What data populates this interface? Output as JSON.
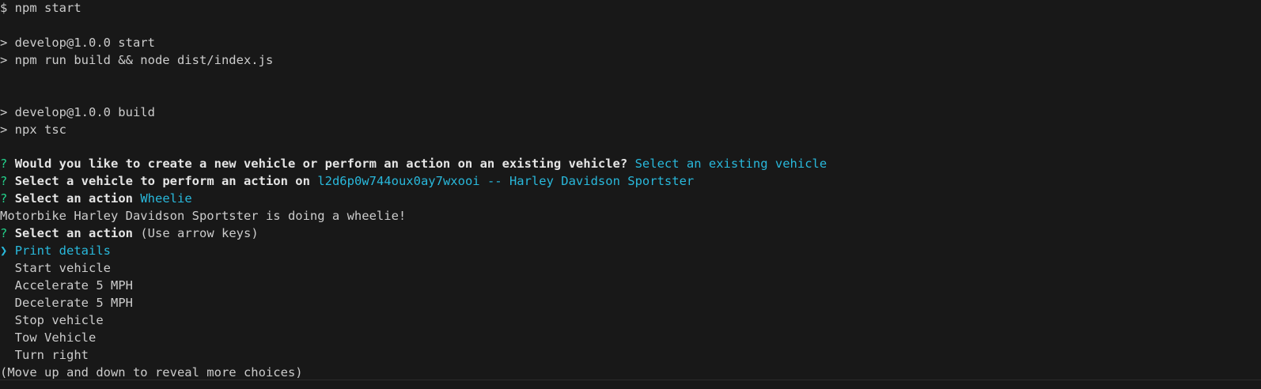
{
  "terminal": {
    "lines": {
      "cmd": "$ npm start",
      "start_script": "> develop@1.0.0 start",
      "start_cmd": "> npm run build && node dist/index.js",
      "build_script": "> develop@1.0.0 build",
      "build_cmd": "> npx tsc"
    },
    "prompts": {
      "q1": {
        "mark": "?",
        "question": "Would you like to create a new vehicle or perform an action on an existing vehicle?",
        "answer": "Select an existing vehicle"
      },
      "q2": {
        "mark": "?",
        "question": "Select a vehicle to perform an action on",
        "answer": "l2d6p0w744oux0ay7wxooi -- Harley Davidson Sportster"
      },
      "q3": {
        "mark": "?",
        "question": "Select an action",
        "answer": "Wheelie"
      },
      "output": "Motorbike Harley Davidson Sportster is doing a wheelie!",
      "q4": {
        "mark": "?",
        "question": "Select an action",
        "hint": "(Use arrow keys)"
      }
    },
    "choices": {
      "pointer": "❯",
      "selected": "Print details",
      "items": [
        "Start vehicle",
        "Accelerate 5 MPH",
        "Decelerate 5 MPH",
        "Stop vehicle",
        "Tow Vehicle",
        "Turn right"
      ],
      "more_hint": "(Move up and down to reveal more choices)"
    }
  },
  "colors": {
    "background": "#181818",
    "text": "#cccccc",
    "question_mark": "#23d18b",
    "answer": "#29b8db"
  }
}
